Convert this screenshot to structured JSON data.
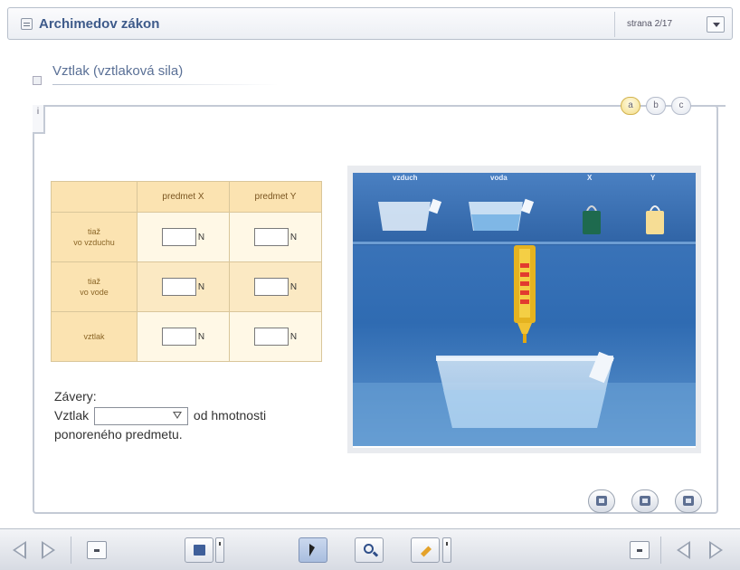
{
  "header": {
    "title": "Archimedov zákon",
    "page_indicator": "strana 2/17"
  },
  "section": {
    "subtitle": "Vztlak (vztlaková sila)",
    "info_tab": "i"
  },
  "steps": [
    "a",
    "b",
    "c"
  ],
  "table": {
    "columns": [
      "",
      "predmet X",
      "predmet Y"
    ],
    "rows": [
      {
        "label_line1": "tiaž",
        "label_line2": "vo vzduchu",
        "unit_x": "N",
        "unit_y": "N"
      },
      {
        "label_line1": "tiaž",
        "label_line2": "vo vode",
        "unit_x": "N",
        "unit_y": "N"
      },
      {
        "label_line1": "vztlak",
        "label_line2": "",
        "unit_x": "N",
        "unit_y": "N"
      }
    ]
  },
  "conclusions": {
    "heading": "Závery:",
    "before_select": "Vztlak",
    "select_value": "",
    "after_select": "od hmotnosti",
    "line3": "ponoreného predmetu."
  },
  "simulation": {
    "labels": [
      "vzduch",
      "voda",
      "X",
      "Y"
    ]
  },
  "icons": {
    "menu": "menu-icon",
    "dropdown": "chevron-down-icon",
    "prev": "arrow-left-icon",
    "next": "arrow-right-icon",
    "save": "save-icon",
    "pointer": "pointer-icon",
    "zoom": "magnifier-icon",
    "pencil": "pencil-icon"
  },
  "colors": {
    "accent_title": "#3d5a8a",
    "table_header": "#fbe3b1",
    "water": "#3a73b5"
  }
}
